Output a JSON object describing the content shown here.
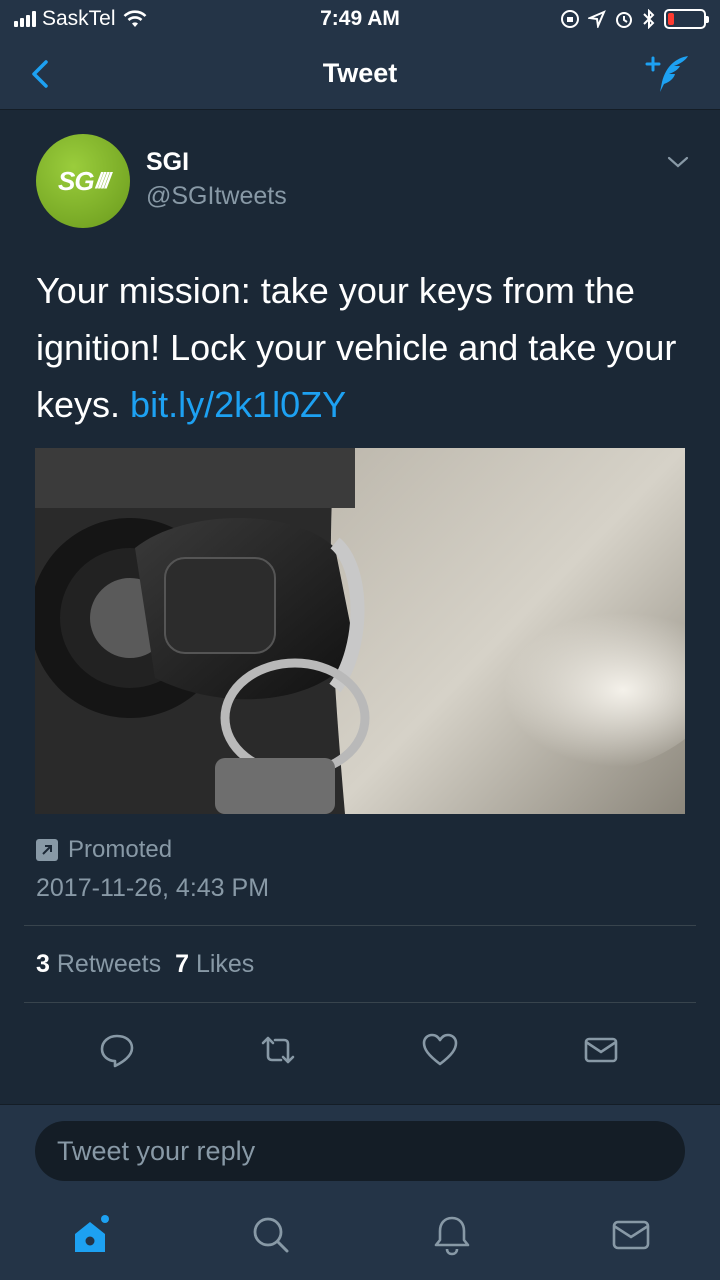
{
  "status_bar": {
    "carrier": "SaskTel",
    "time": "7:49 AM"
  },
  "nav": {
    "title": "Tweet"
  },
  "tweet": {
    "author_name": "SGI",
    "author_handle": "@SGItweets",
    "avatar_text": "SG",
    "text": "Your mission: take your keys from the ignition! Lock your vehicle and take your keys.",
    "link": "bit.ly/2k1l0ZY",
    "promoted_label": "Promoted",
    "timestamp": "2017-11-26, 4:43 PM",
    "retweets_count": "3",
    "retweets_label": "Retweets",
    "likes_count": "7",
    "likes_label": "Likes"
  },
  "reply": {
    "placeholder": "Tweet your reply"
  },
  "tabs": [
    "home-icon",
    "search-icon",
    "notifications-icon",
    "messages-icon"
  ],
  "colors": {
    "background": "#1b2836",
    "bar": "#243447",
    "accent": "#1da1f2",
    "secondary_text": "#8899a6",
    "avatar_green": "#7fb02a"
  }
}
